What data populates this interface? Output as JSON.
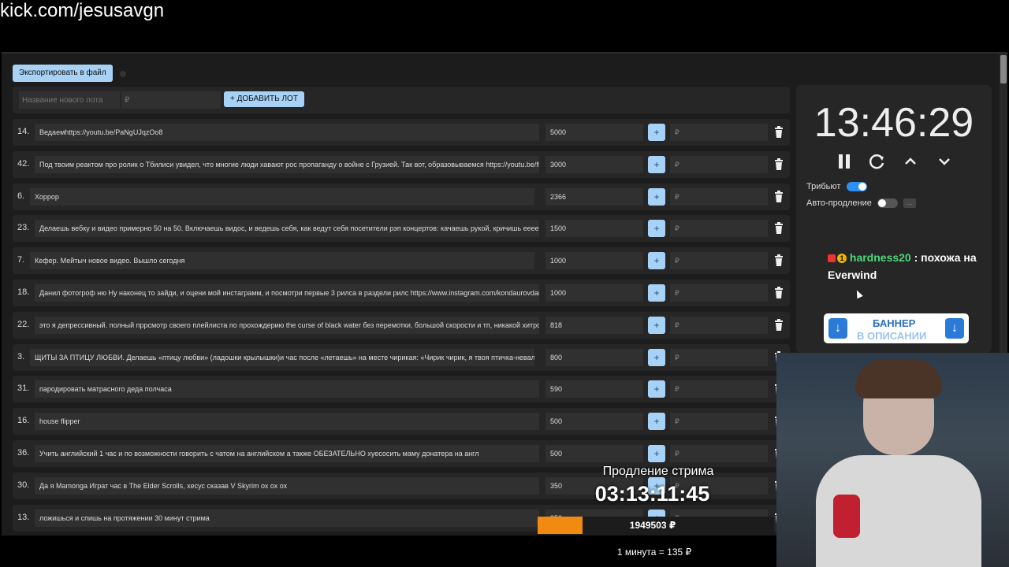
{
  "overlay": {
    "url": "kick.com/jesusavgn"
  },
  "toolbar": {
    "export_label": "Экспортировать в файл"
  },
  "add_lot": {
    "name_placeholder": "Название нового лота",
    "price_placeholder": "₽",
    "add_label": "+ ДОБАВИТЬ ЛОТ"
  },
  "lots": [
    {
      "num": "14.",
      "name": "Ведаемhttps://youtu.be/PaNgUJqzOo8",
      "amount": "5000"
    },
    {
      "num": "42.",
      "name": "Под твоим реактом про ролик о Тбилиси увидел, что многие люди хавают рос пропаганду о войне с Грузией. Так вот, образовываемся https://youtu.be/fFV",
      "amount": "3000"
    },
    {
      "num": "6.",
      "name": "Хоррор",
      "amount": "2366"
    },
    {
      "num": "23.",
      "name": "Делаешь вебку и видео примерно 50 на 50. Включаешь видос, и ведешь себя, как ведут себя посетители рэп концертов: качаешь рукой, кричишь ееее, и",
      "amount": "1500"
    },
    {
      "num": "7.",
      "name": "Кефер. Мейтыч новое видео. Вышло сегодня",
      "amount": "1000"
    },
    {
      "num": "18.",
      "name": "Данил фотогроф ню Ну наконец то зайди, и оцени мой инстаграмм, и посмотри первые 3 рилса в раздели рилс https://www.instagram.com/kondaurovdany",
      "amount": "1000"
    },
    {
      "num": "22.",
      "name": "это я депрессивный. полный пррсмотр своего плейлиста по прохождерию the curse of black water без перемотки, большой скорости и тп, никакой хитрос",
      "amount": "818"
    },
    {
      "num": "3.",
      "name": "ЩИТЫ ЗА ПТИЦУ ЛЮБВИ. Делаешь «птицу любви» (ладошки крылышки)и час после «летаешь» на месте чирикая: «Чирик чирик, я твоя птичка-неваляш",
      "amount": "800"
    },
    {
      "num": "31.",
      "name": "пародировать матрасного деда полчаса",
      "amount": "590"
    },
    {
      "num": "16.",
      "name": "house flipper",
      "amount": "500"
    },
    {
      "num": "36.",
      "name": "Учить английский 1 час и по возможности говорить с чатом на английском а также ОБЕЗАТЕЛЬНО хуесосить маму донатера на англ",
      "amount": "500"
    },
    {
      "num": "30.",
      "name": "Да я Mamonga Играт час в The Elder Scrolls, хесус сказав V Skyrim ох ох ох",
      "amount": "350"
    },
    {
      "num": "13.",
      "name": "ложишься и спишь на протяжении 30 минут стрима",
      "amount": "350"
    }
  ],
  "lot_currency": "₽",
  "plus_label": "+",
  "timer_panel": {
    "time": "13:46:29",
    "tribute_label": "Трибьют",
    "tribute_on": true,
    "autoextend_label": "Авто-продление",
    "autoextend_on": false,
    "more_label": "..."
  },
  "chat": {
    "user": "hardness20",
    "separator": " : ",
    "message": "похожа на Everwind",
    "badge_number": "1"
  },
  "banner": {
    "line1": "БАННЕР",
    "line2": "В ОПИСАНИИ"
  },
  "stream_extension": {
    "label": "Продление стрима",
    "timer": "03:13:11:45",
    "total": "1949503 ₽",
    "progress_fraction": 0.19,
    "rate": "1 минута = 135 ₽"
  },
  "colors": {
    "accent": "#a7d1f5",
    "progress": "#f08a10",
    "chat_user": "#4fd67a",
    "toggle_on": "#2f8ff0"
  }
}
